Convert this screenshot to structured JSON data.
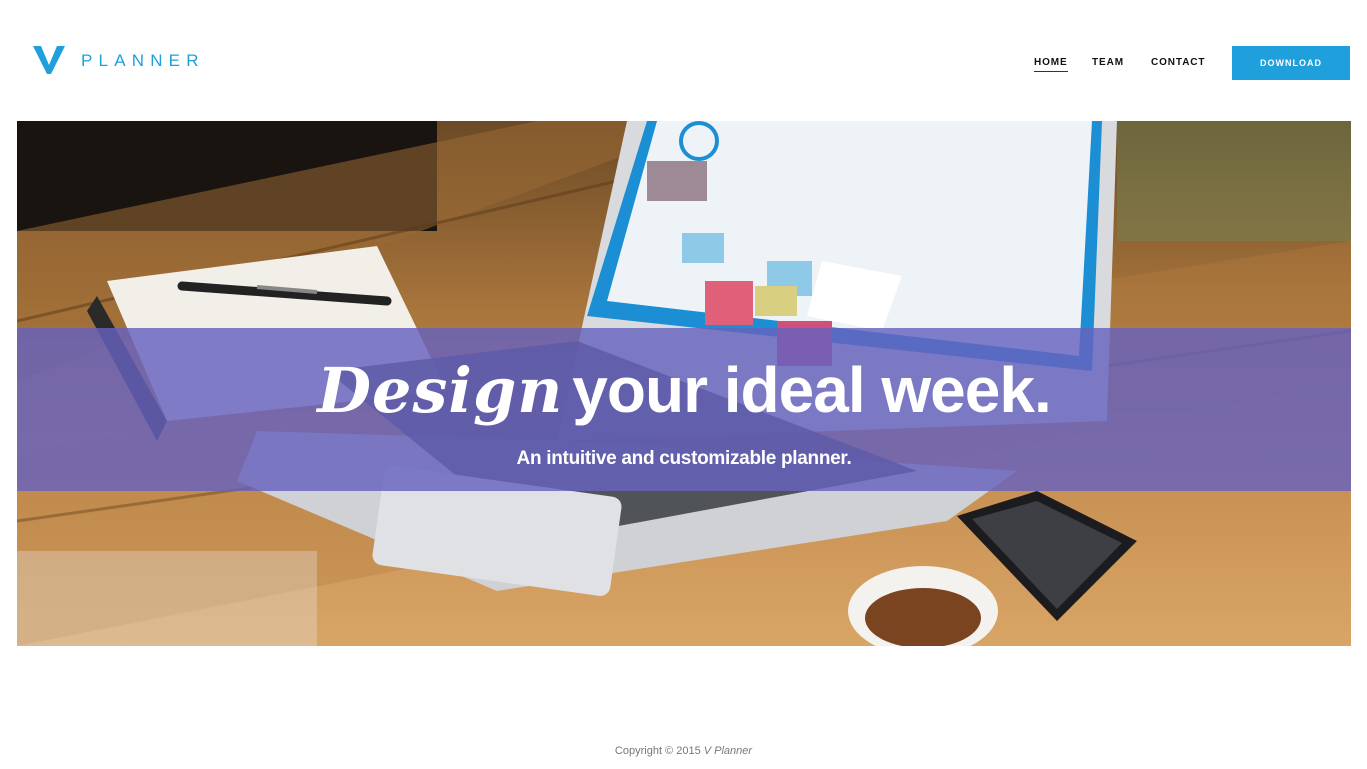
{
  "header": {
    "logo_text": "PLANNER",
    "nav": [
      {
        "label": "HOME",
        "active": true
      },
      {
        "label": "TEAM",
        "active": false
      },
      {
        "label": "CONTACT",
        "active": false
      }
    ],
    "download_label": "DOWNLOAD"
  },
  "hero": {
    "headline_script": "Design",
    "headline_main": "your ideal week.",
    "subtitle": "An intuitive and customizable planner."
  },
  "footer": {
    "copyright": "Copyright © 2015 ",
    "brand": "V Planner"
  },
  "colors": {
    "accent": "#1f9fdc",
    "band": "#6762be"
  }
}
